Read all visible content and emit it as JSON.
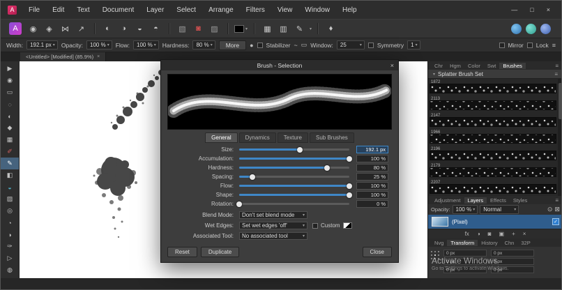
{
  "window_controls": {
    "minimize": "—",
    "maximize": "□",
    "close": "×"
  },
  "menu": {
    "items": [
      "File",
      "Edit",
      "Text",
      "Document",
      "Layer",
      "Select",
      "Arrange",
      "Filters",
      "View",
      "Window",
      "Help"
    ]
  },
  "context": {
    "width_label": "Width:",
    "width_value": "192.1 px",
    "opacity_label": "Opacity:",
    "opacity_value": "100 %",
    "flow_label": "Flow:",
    "flow_value": "100 %",
    "hardness_label": "Hardness:",
    "hardness_value": "80 %",
    "more_label": "More",
    "stabilizer_label": "Stabilizer",
    "window_label": "Window:",
    "window_value": "25",
    "symmetry_label": "Symmetry",
    "symmetry_value": "1",
    "mirror_label": "Mirror",
    "lock_label": "Lock"
  },
  "document_tab": {
    "title": "<Untitled> [Modified] (85.9%)"
  },
  "tools": {
    "items": [
      {
        "name": "move-tool",
        "glyph": "▶"
      },
      {
        "name": "view-tool",
        "glyph": "◉"
      },
      {
        "name": "marquee-select-tool",
        "glyph": "▭"
      },
      {
        "name": "lasso-select-tool",
        "glyph": "◌"
      },
      {
        "name": "selection-brush-tool",
        "glyph": "◐"
      },
      {
        "name": "flood-select-tool",
        "glyph": "◆"
      },
      {
        "name": "crop-tool",
        "glyph": "▦"
      },
      {
        "name": "colour-picker-tool",
        "glyph": "✐"
      },
      {
        "name": "paint-brush-tool",
        "glyph": "✎"
      },
      {
        "name": "erase-brush-tool",
        "glyph": "◧"
      },
      {
        "name": "fill-tool",
        "glyph": "◒"
      },
      {
        "name": "gradient-tool",
        "glyph": "▨"
      },
      {
        "name": "clone-brush-tool",
        "glyph": "◎"
      },
      {
        "name": "blur-brush-tool",
        "glyph": "◔"
      },
      {
        "name": "dodge-brush-tool",
        "glyph": "◑"
      },
      {
        "name": "pen-tool",
        "glyph": "✑"
      },
      {
        "name": "node-tool",
        "glyph": "▷"
      },
      {
        "name": "zoom-tool",
        "glyph": "◍"
      }
    ]
  },
  "dialog": {
    "title": "Brush - Selection",
    "tabs": [
      "General",
      "Dynamics",
      "Texture",
      "Sub Brushes"
    ],
    "sliders": [
      {
        "label": "Size:",
        "value": "192.1 px",
        "pos": 55
      },
      {
        "label": "Accumulation:",
        "value": "100 %",
        "pos": 100
      },
      {
        "label": "Hardness:",
        "value": "80 %",
        "pos": 80
      },
      {
        "label": "Spacing:",
        "value": "25 %",
        "pos": 12
      },
      {
        "label": "Flow:",
        "value": "100 %",
        "pos": 100
      },
      {
        "label": "Shape:",
        "value": "100 %",
        "pos": 100
      },
      {
        "label": "Rotation:",
        "value": "0 %",
        "pos": 0
      }
    ],
    "blend_mode_label": "Blend Mode:",
    "blend_mode_value": "Don't set blend mode",
    "wet_edges_label": "Wet Edges:",
    "wet_edges_value": "Set wet edges 'off'",
    "custom_label": "Custom",
    "associated_label": "Associated Tool:",
    "associated_value": "No associated tool",
    "reset_label": "Reset",
    "duplicate_label": "Duplicate",
    "close_label": "Close"
  },
  "panels": {
    "top_tabs": [
      "Chr",
      "Hgm",
      "Color",
      "Swt",
      "Brushes"
    ],
    "brush_set_title": "Splatter Brush Set",
    "brushes": {
      "items": [
        {
          "id": "1872"
        },
        {
          "id": "2113"
        },
        {
          "id": "2147"
        },
        {
          "id": "1966"
        },
        {
          "id": "2196"
        },
        {
          "id": "2179"
        },
        {
          "id": "2207"
        }
      ]
    },
    "mid_tabs": [
      "Adjustment",
      "Layers",
      "Effects",
      "Styles"
    ],
    "layers": {
      "opacity_label": "Opacity:",
      "opacity_value": "100 %",
      "blend_value": "Normal",
      "layer_name": "(Pixel)"
    },
    "bottom_tabs": [
      "Nvg",
      "Transform",
      "History",
      "Chn",
      "32P"
    ],
    "transform": {
      "values": [
        "0 px",
        "0 px",
        "0 px",
        "0 px",
        "0 px",
        "0 px"
      ]
    }
  },
  "watermark": {
    "line1": "Activate Windows",
    "line2": "Go to Settings to activate Windows."
  },
  "icons": {
    "app_letter": "A",
    "caret_down": "▾",
    "burger": "≡",
    "liquify": "◉",
    "develop": "◈",
    "tonemap": "⋈",
    "share": "↗",
    "auto_levels": "◐",
    "auto_contrast": "◑",
    "auto_colours": "◒",
    "auto_wb": "◓",
    "marquee": "▧",
    "quick_mask": "◙",
    "refine": "▨",
    "grid": "▦",
    "snap": "▥",
    "brush_pen": "✎",
    "assistant": "♦",
    "rope": "~",
    "stab_win": "▭",
    "brush_tip": "●",
    "gear": "⊙",
    "lock": "⊠",
    "check": "✓",
    "fx": "fx",
    "adj_half": "◑",
    "mask": "◙",
    "group": "▣",
    "plus": "+",
    "delete": "×"
  }
}
